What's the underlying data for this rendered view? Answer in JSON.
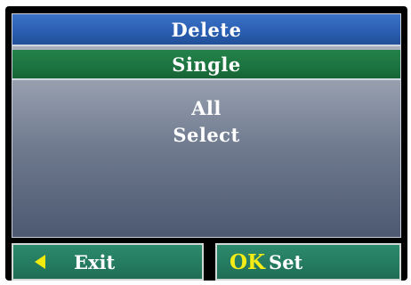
{
  "menu": {
    "title": "Delete",
    "items": [
      {
        "label": "Single",
        "selected": true
      },
      {
        "label": "All",
        "selected": false
      },
      {
        "label": "Select",
        "selected": false
      }
    ]
  },
  "footer": {
    "exit_label": "Exit",
    "ok_key": "OK",
    "ok_label": "Set"
  },
  "colors": {
    "title_bar": "#2a5fb3",
    "selected_item": "#1c733f",
    "footer_button": "#247a5f",
    "accent_yellow": "#f4ec16",
    "text": "#ffffff"
  },
  "icons": {
    "exit": "left-arrow-icon"
  }
}
